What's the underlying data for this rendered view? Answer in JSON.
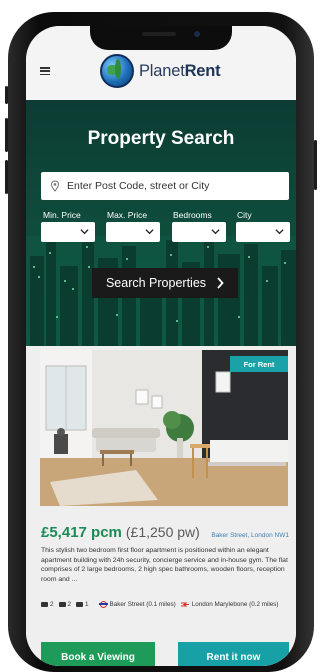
{
  "header": {
    "logo_regular": "Planet",
    "logo_bold": "Rent"
  },
  "search": {
    "title": "Property Search",
    "placeholder": "Enter Post Code, street or City",
    "min_price_label": "Min. Price",
    "max_price_label": "Max. Price",
    "bedrooms_label": "Bedrooms",
    "city_label": "City",
    "button_label": "Search Properties"
  },
  "listing": {
    "tag": "For Rent",
    "price_pcm": "£5,417 pcm",
    "price_pw": "(£1,250 pw)",
    "location": "Baker Street, London NW1",
    "description": "This stylish two bedroom first floor apartment is positioned within an elegant apartment building with 24h security, concierge service and in-house gym. The flat comprises of 2 large bedrooms, 2 high spec bathrooms, wooden floors, reception room and ...",
    "beds": "2",
    "baths": "2",
    "receptions": "1",
    "station_1": "Baker Street (0.1 miles)",
    "station_2": "London Marylebone (0.2 miles)",
    "btn_view": "Book a Viewing",
    "btn_rent": "Rent it now"
  },
  "colors": {
    "hero": "#0e4a3b",
    "price_green": "#1b8a55",
    "teal": "#17a0a6",
    "dark_button": "#1a1a1a"
  }
}
